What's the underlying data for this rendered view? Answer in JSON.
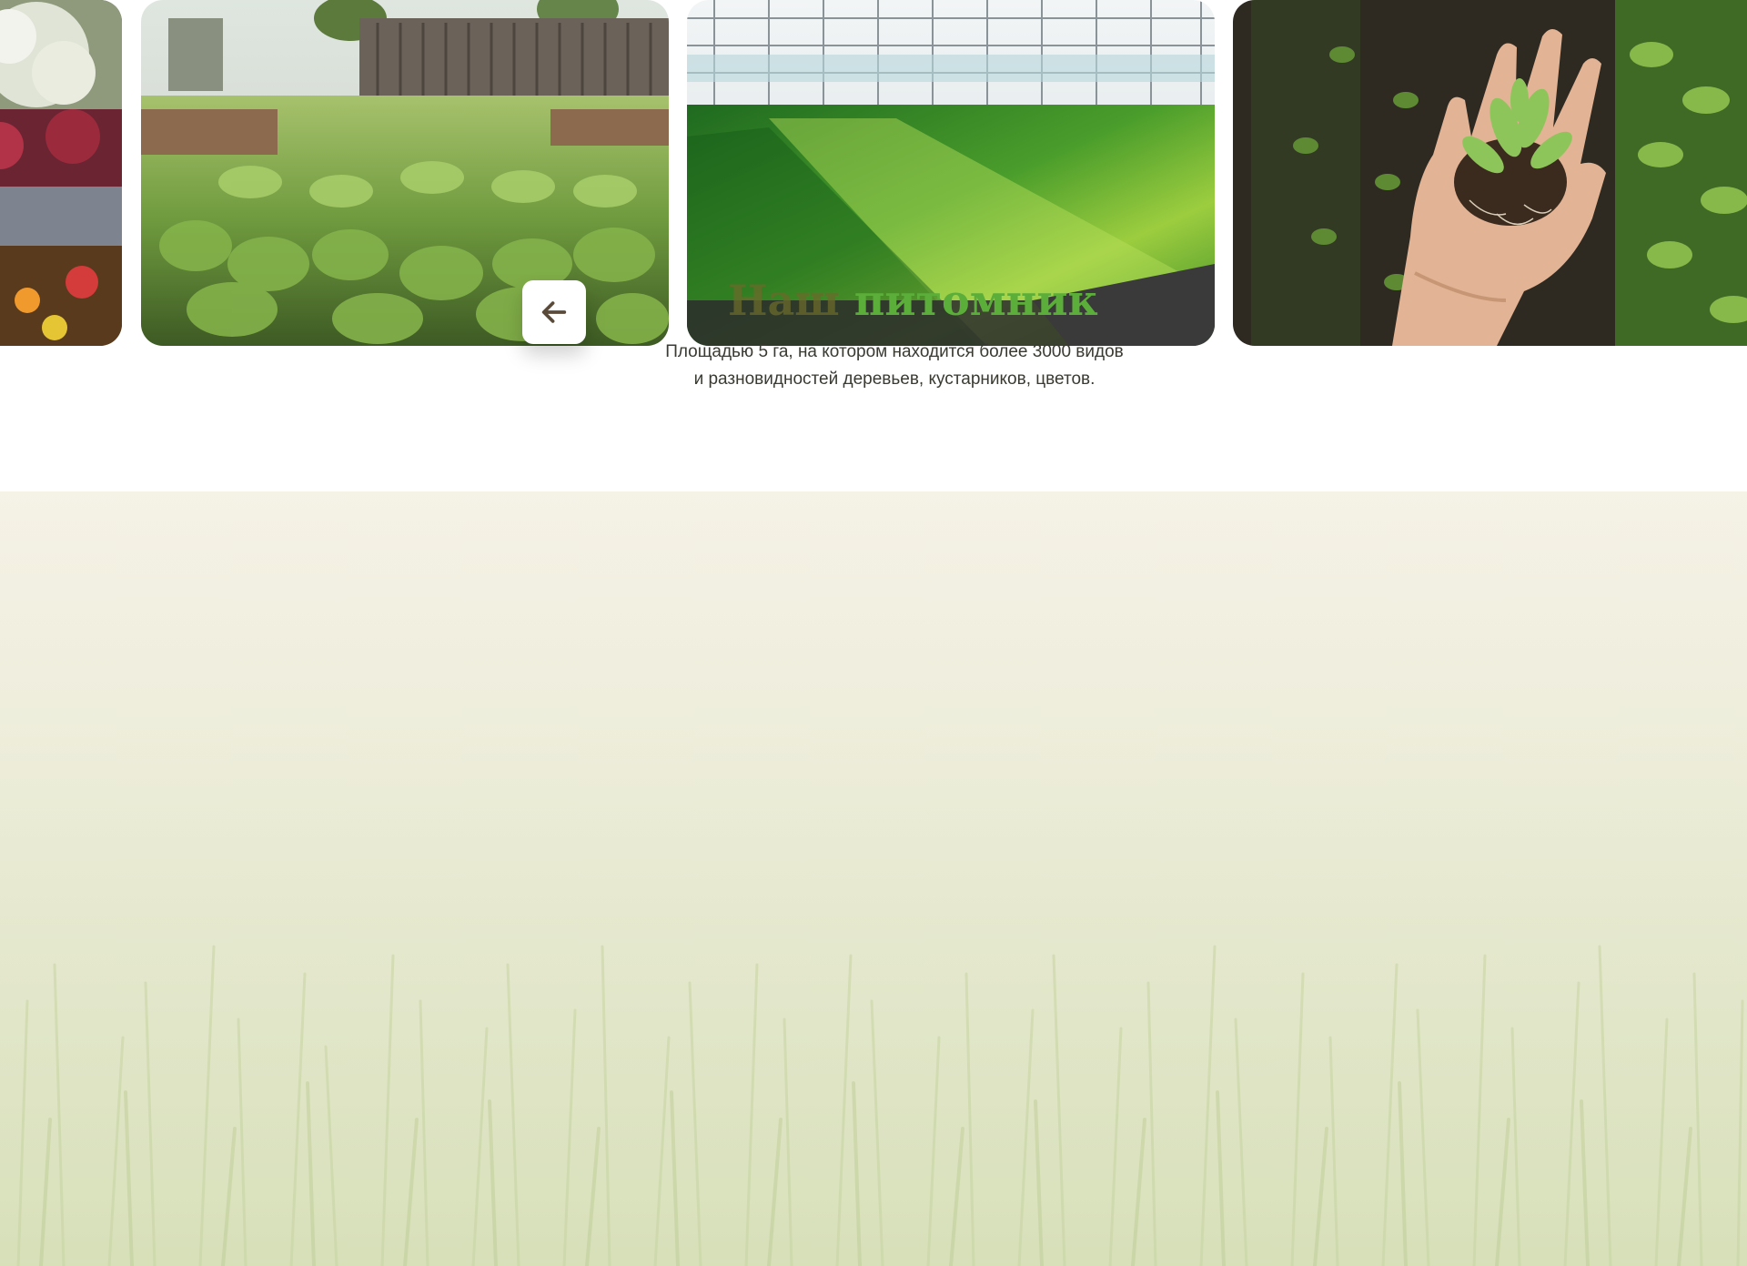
{
  "carousel": {
    "slides": [
      {
        "image": "flower-stall-photo"
      },
      {
        "image": "seedling-beds-photo"
      },
      {
        "image": "greenhouse-photo"
      },
      {
        "image": "hand-with-seedlings-photo"
      }
    ],
    "prev_icon": "arrow-left-icon"
  },
  "section": {
    "title_word1": "Наш",
    "title_word2": "питомник",
    "description_line1": "Площадью 5 га, на котором находится более 3000 видов",
    "description_line2": "и разновидностей деревьев, кустарников, цветов."
  },
  "background": {
    "image": "grass-field-background"
  },
  "colors": {
    "title_accent": "#5cae3a",
    "title_dark": "#6b6a2a",
    "text": "#3a3a32",
    "section_bg": "#f5f2e6"
  }
}
